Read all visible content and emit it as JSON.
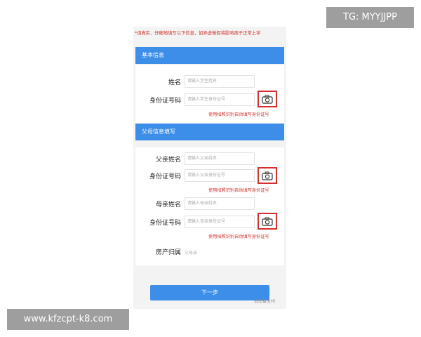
{
  "notice": "*请真实、仔细地填写以下信息，如弄虚做假将影响孩子正常上学",
  "basic_section": {
    "title": "基本信息",
    "name_label": "姓名",
    "name_placeholder": "请输入学生姓名",
    "id_label": "身份证号码",
    "id_placeholder": "请输入学生身份证号",
    "camera_hint": "使用拍照识别自动填写身份证号"
  },
  "parent_section": {
    "title": "父母信息填写",
    "father_name_label": "父亲姓名",
    "father_name_placeholder": "请输入父亲姓名",
    "father_id_label": "身份证号码",
    "father_id_placeholder": "请输入父亲身份证号",
    "father_camera_hint": "使用拍照识别自动填写身份证号",
    "mother_name_label": "母亲姓名",
    "mother_name_placeholder": "请输入母亲姓名",
    "mother_id_label": "身份证号码",
    "mother_id_placeholder": "请输入母亲身份证号",
    "mother_camera_hint": "使用拍照识别自动填写身份证号",
    "property_label": "房产归属",
    "property_value": "父母亲"
  },
  "next_button": "下一步",
  "watermark_small": "云南省全州",
  "overlay": {
    "tg": "TG: MYYJJPP",
    "site": "www.kfzcpt-k8.com"
  },
  "colors": {
    "accent": "#3d8ee8",
    "warning": "#d0342c",
    "camera_border": "#d32f2f"
  },
  "icons": [
    "camera-icon"
  ]
}
